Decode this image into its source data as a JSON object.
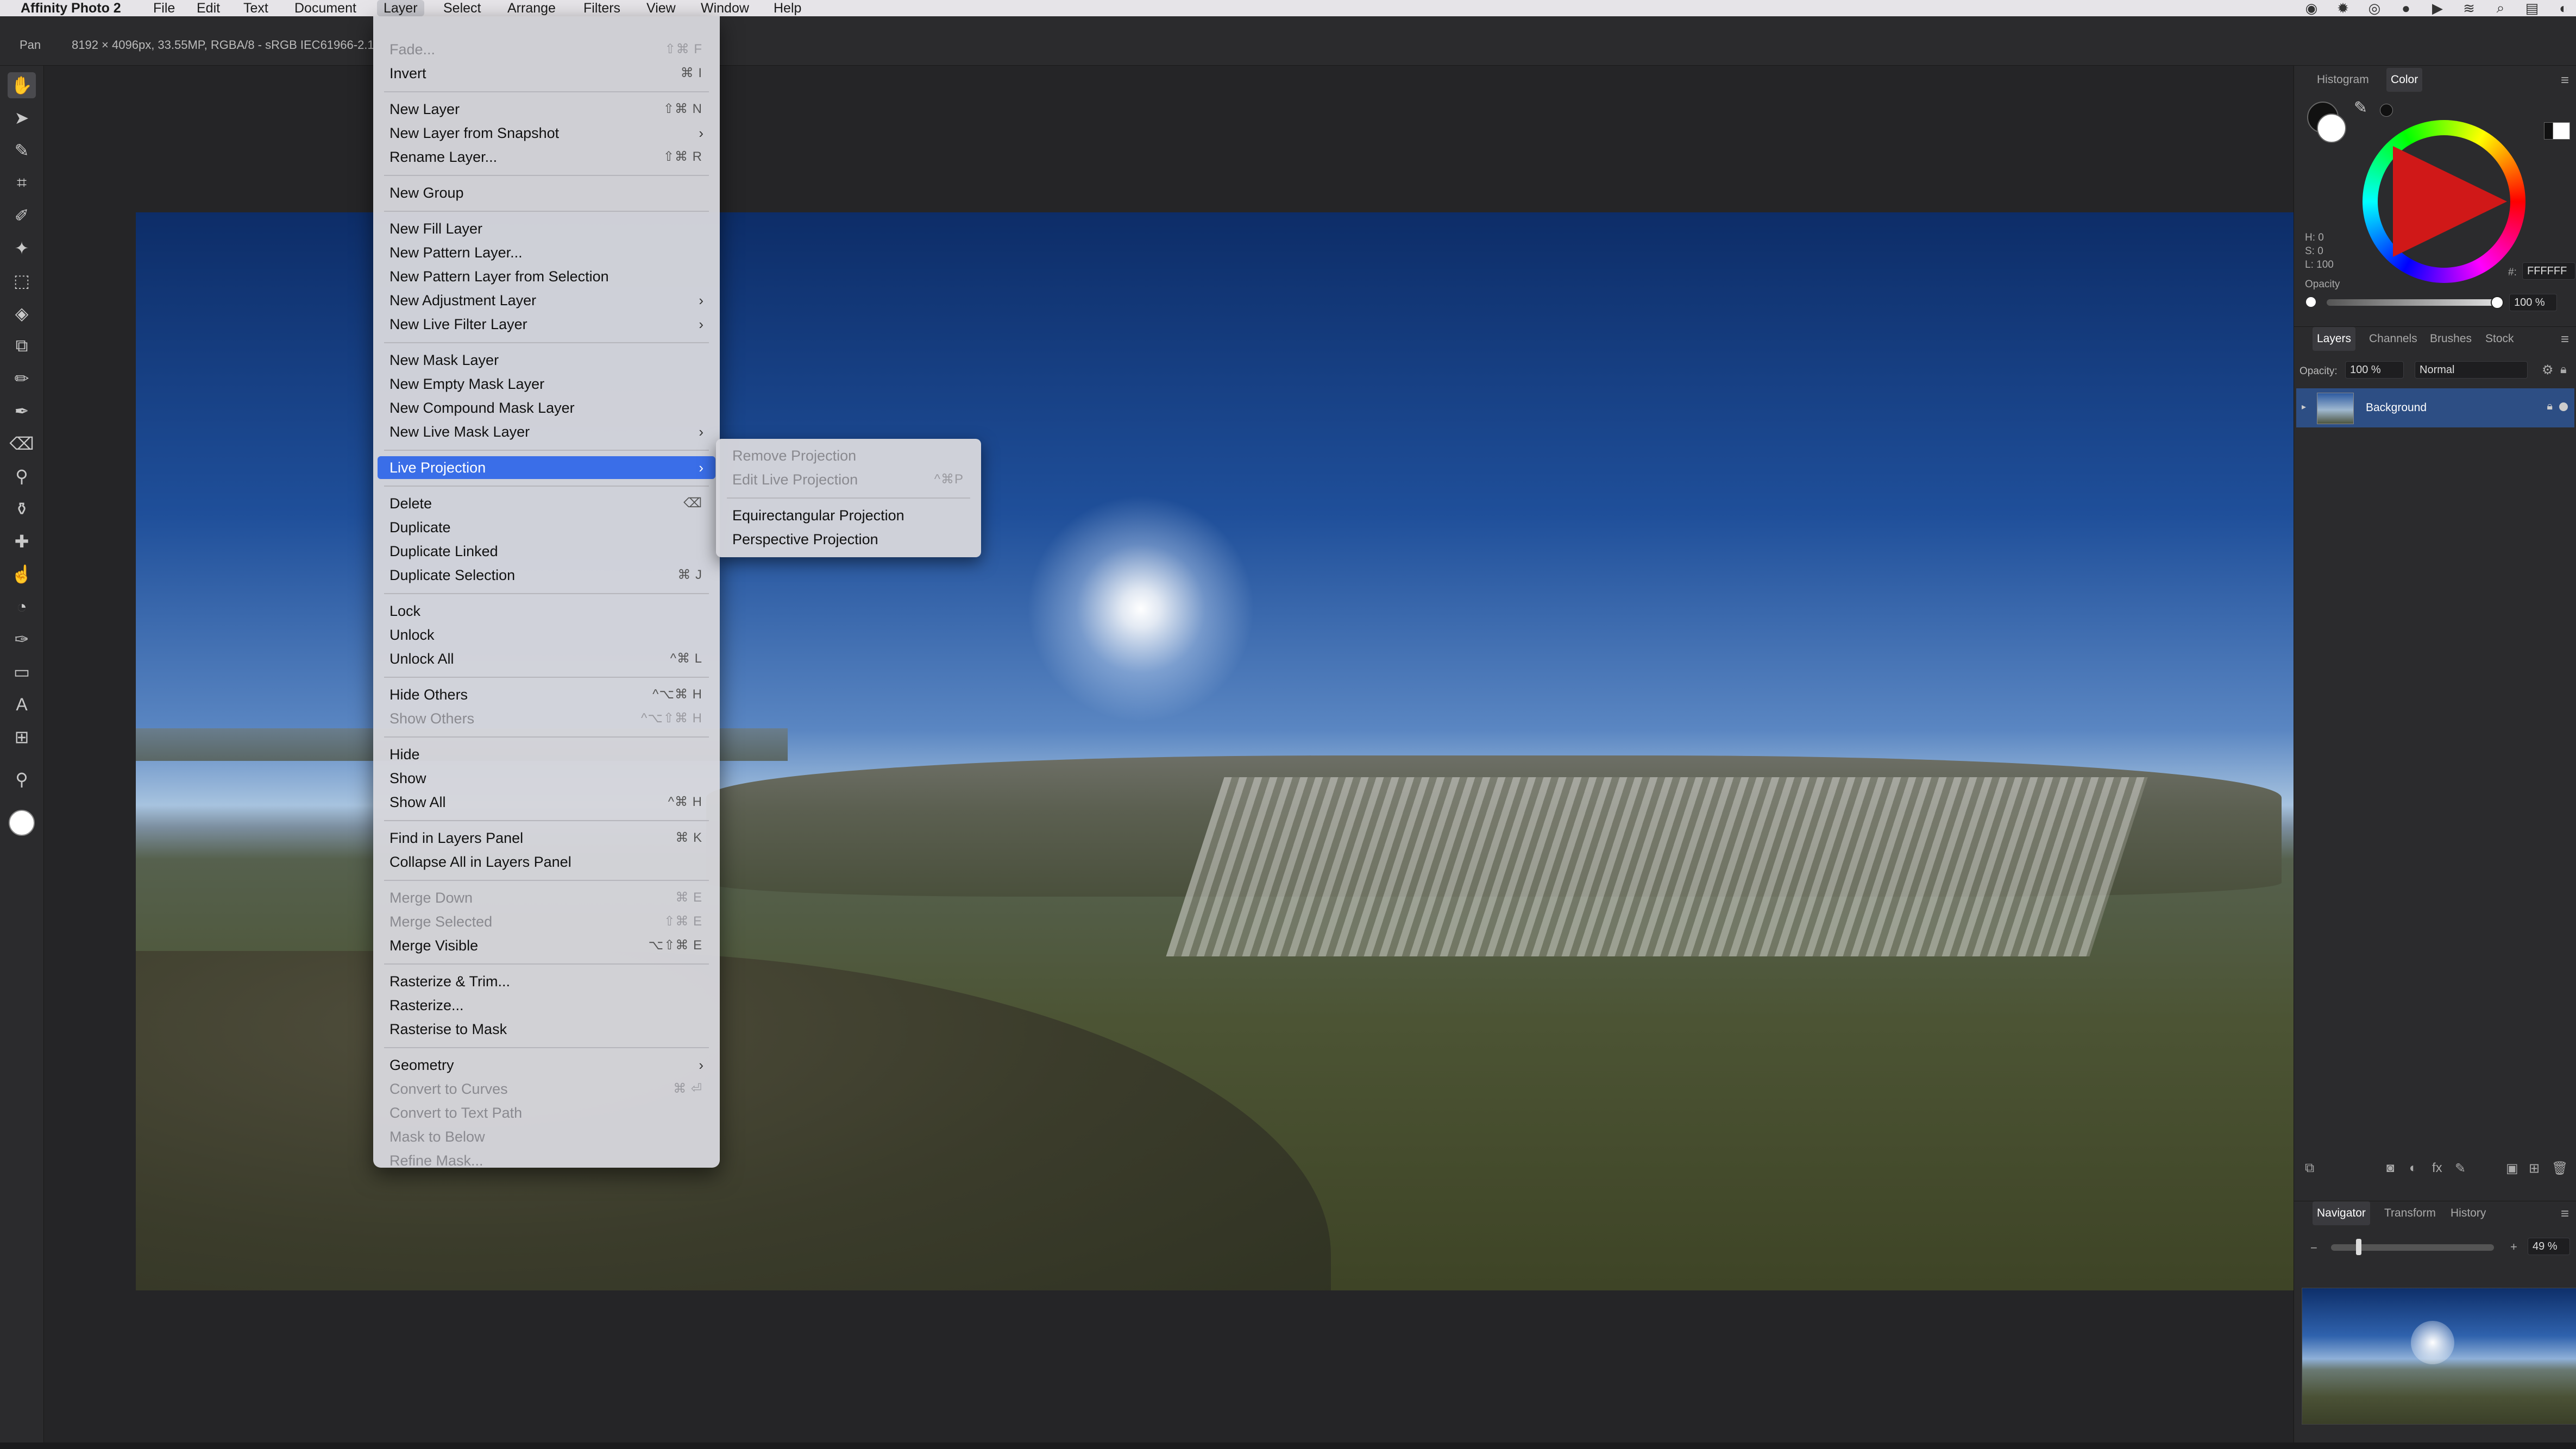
{
  "menubar": {
    "app": "Affinity Photo 2",
    "items": [
      "File",
      "Edit",
      "Text",
      "Document",
      "Layer",
      "Select",
      "Arrange",
      "Filters",
      "View",
      "Window",
      "Help"
    ],
    "active": "Layer"
  },
  "contextbar": {
    "tool": "Pan",
    "info": "8192 × 4096px, 33.55MP, RGBA/8 - sRGB IEC61966-2.1"
  },
  "layer_menu": {
    "items": [
      {
        "label": "Fade...",
        "shortcut": "⇧⌘ F",
        "disabled": true
      },
      {
        "label": "Invert",
        "shortcut": "⌘ I"
      },
      {
        "sep": true
      },
      {
        "label": "New Layer",
        "shortcut": "⇧⌘ N"
      },
      {
        "label": "New Layer from Snapshot",
        "submenu": true
      },
      {
        "label": "Rename Layer...",
        "shortcut": "⇧⌘ R"
      },
      {
        "sep": true
      },
      {
        "label": "New Group"
      },
      {
        "sep": true
      },
      {
        "label": "New Fill Layer"
      },
      {
        "label": "New Pattern Layer..."
      },
      {
        "label": "New Pattern Layer from Selection"
      },
      {
        "label": "New Adjustment Layer",
        "submenu": true
      },
      {
        "label": "New Live Filter Layer",
        "submenu": true
      },
      {
        "sep": true
      },
      {
        "label": "New Mask Layer"
      },
      {
        "label": "New Empty Mask Layer"
      },
      {
        "label": "New Compound Mask Layer"
      },
      {
        "label": "New Live Mask Layer",
        "submenu": true
      },
      {
        "sep": true
      },
      {
        "label": "Live Projection",
        "submenu": true,
        "highlight": true
      },
      {
        "sep": true
      },
      {
        "label": "Delete",
        "shortcut": "⌫"
      },
      {
        "label": "Duplicate"
      },
      {
        "label": "Duplicate Linked"
      },
      {
        "label": "Duplicate Selection",
        "shortcut": "⌘ J"
      },
      {
        "sep": true
      },
      {
        "label": "Lock"
      },
      {
        "label": "Unlock"
      },
      {
        "label": "Unlock All",
        "shortcut": "^⌘ L"
      },
      {
        "sep": true
      },
      {
        "label": "Hide Others",
        "shortcut": "^⌥⌘ H"
      },
      {
        "label": "Show Others",
        "shortcut": "^⌥⇧⌘ H",
        "disabled": true
      },
      {
        "sep": true
      },
      {
        "label": "Hide"
      },
      {
        "label": "Show"
      },
      {
        "label": "Show All",
        "shortcut": "^⌘ H"
      },
      {
        "sep": true
      },
      {
        "label": "Find in Layers Panel",
        "shortcut": "⌘ K"
      },
      {
        "label": "Collapse All in Layers Panel"
      },
      {
        "sep": true
      },
      {
        "label": "Merge Down",
        "shortcut": "⌘ E",
        "disabled": true
      },
      {
        "label": "Merge Selected",
        "shortcut": "⇧⌘ E",
        "disabled": true
      },
      {
        "label": "Merge Visible",
        "shortcut": "⌥⇧⌘ E"
      },
      {
        "sep": true
      },
      {
        "label": "Rasterize & Trim..."
      },
      {
        "label": "Rasterize..."
      },
      {
        "label": "Rasterise to Mask"
      },
      {
        "sep": true
      },
      {
        "label": "Geometry",
        "submenu": true
      },
      {
        "label": "Convert to Curves",
        "shortcut": "⌘ ⏎",
        "disabled": true
      },
      {
        "label": "Convert to Text Path",
        "disabled": true
      },
      {
        "label": "Mask to Below",
        "disabled": true
      },
      {
        "label": "Refine Mask...",
        "disabled": true
      }
    ]
  },
  "live_projection_submenu": {
    "items": [
      {
        "label": "Remove Projection",
        "disabled": true
      },
      {
        "label": "Edit Live Projection",
        "shortcut": "^⌘P",
        "disabled": true
      },
      {
        "sep": true
      },
      {
        "label": "Equirectangular Projection"
      },
      {
        "label": "Perspective Projection"
      }
    ]
  },
  "color_panel": {
    "tabs": [
      "Histogram",
      "Color"
    ],
    "active_tab": "Color",
    "h": "H: 0",
    "s": "S: 0",
    "l": "L: 100",
    "hex_label": "#:",
    "hex": "FFFFFF",
    "opacity_label": "Opacity",
    "opacity": "100 %",
    "accent": "#d01818"
  },
  "layers_panel": {
    "tabs": [
      "Layers",
      "Channels",
      "Brushes",
      "Stock"
    ],
    "active_tab": "Layers",
    "opacity_label": "Opacity:",
    "opacity": "100 %",
    "blend_mode": "Normal",
    "layers": [
      {
        "name": "Background",
        "locked": true
      }
    ]
  },
  "navigator_panel": {
    "tabs": [
      "Navigator",
      "Transform",
      "History"
    ],
    "active_tab": "Navigator",
    "zoom": "49 %"
  }
}
